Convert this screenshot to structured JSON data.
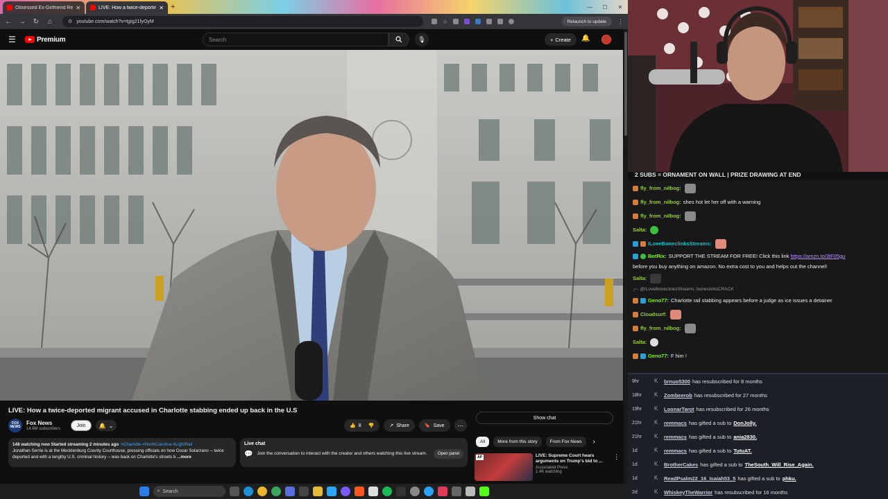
{
  "browser": {
    "tabs": [
      {
        "title": "Obsessed Ex-Girlfriend Refuses",
        "active": false
      },
      {
        "title": "LIVE: How a twice-deported",
        "active": true
      }
    ],
    "url": "youtube.com/watch?v=tgIg21fyOyM",
    "relaunch_label": "Relaunch to update"
  },
  "youtube": {
    "brand": "Premium",
    "search_placeholder": "Search",
    "create_label": "Create",
    "video_title": "LIVE: How a twice-deported migrant accused in Charlotte stabbing ended up back in the U.S",
    "channel": {
      "name": "Fox News",
      "subscribers": "14.6M subscribers",
      "avatar_text": "FOX NEWS"
    },
    "join_label": "Join",
    "like_count": "8",
    "share_label": "Share",
    "save_label": "Save",
    "description": {
      "stats": "148 watching now  Started streaming 2 minutes ago",
      "tags": "#Charlotte #NorthCarolina #LightRail",
      "body": "Jonathan Serrie is at the Mecklenburg County Courthouse, pressing officials on how Oscar Solarzano -- twice deported and with a lengthy U.S. criminal history -- was back on Charlotte's streets b",
      "more": "...more"
    },
    "live_chat": {
      "heading": "Live chat",
      "text": "Join the conversation to interact with the creator and others watching this live stream.",
      "open_panel": "Open panel"
    },
    "show_chat": "Show chat",
    "chips": [
      "All",
      "More from this story",
      "From Fox News"
    ],
    "recommendation": {
      "title": "LIVE: Supreme Court hears arguments on Trump's bid to ...",
      "channel": "Associated Press",
      "watching": "1.4K watching",
      "thumb_badge": "AP"
    }
  },
  "taskbar": {
    "search_label": "Search"
  },
  "stream": {
    "banner": "2 SUBS = ORNAMENT ON WALL | PRIZE DRAWING AT END",
    "chat": [
      {
        "user": "fly_from_nilbog:",
        "color": "#9acd32",
        "text": "",
        "emote": "cat"
      },
      {
        "user": "fly_from_nilbog:",
        "color": "#9acd32",
        "text": "shes hot let her off with a warning",
        "emote": ""
      },
      {
        "user": "fly_from_nilbog:",
        "color": "#9acd32",
        "text": "",
        "emote": "cat"
      },
      {
        "user": "Salta:",
        "color": "#9acd32",
        "text": "",
        "emote": "green"
      },
      {
        "user": "ILoveBoneclinksStreams:",
        "color": "#00c8c8",
        "text": "",
        "emote": "face"
      },
      {
        "user": "BotRix:",
        "color": "#7cfc00",
        "text": "SUPPORT THE STREAM FOR FREE! Click this link",
        "link": "https://amzn.to/3tF05gu",
        "text2": "before you buy anything on amazon. No extra cost to you and helps out the channel!"
      },
      {
        "user": "Salta:",
        "color": "#9acd32",
        "text": "",
        "emote": "dark"
      },
      {
        "reply": "@ILoveBoneclinksStreams: boneclinksCRACK"
      },
      {
        "user": "Geno77:",
        "color": "#7cfc00",
        "text": "Charlotte rail stabbing appears before a judge as ice issues a detainer",
        "emote": ""
      },
      {
        "user": "Cloudsurf:",
        "color": "#9acd32",
        "text": "",
        "emote": "face"
      },
      {
        "user": "fly_from_nilbog:",
        "color": "#9acd32",
        "text": "",
        "emote": "cat"
      },
      {
        "user": "Salta:",
        "color": "#9acd32",
        "text": "",
        "emote": "skull"
      },
      {
        "user": "Geno77:",
        "color": "#7cfc00",
        "text": "F him !",
        "emote": ""
      }
    ],
    "events": [
      {
        "age": "9hr",
        "user": "brnuo5300",
        "text": "has resubscribed for 8 months",
        "to": ""
      },
      {
        "age": "18hr",
        "user": "Zombeerob",
        "text": "has resubscribed for 27 months",
        "to": ""
      },
      {
        "age": "19hr",
        "user": "LoonarTarot",
        "text": "has resubscribed for 26 months",
        "to": ""
      },
      {
        "age": "21hr",
        "user": "remmacs",
        "text": "has gifted a sub to",
        "to": "DonJolly."
      },
      {
        "age": "21hr",
        "user": "remmacs",
        "text": "has gifted a sub to",
        "to": "ania2830."
      },
      {
        "age": "1d",
        "user": "remmacs",
        "text": "has gifted a sub to",
        "to": "TutuAT."
      },
      {
        "age": "1d",
        "user": "BrotherCakes",
        "text": "has gifted a sub to",
        "to": "TheSouth_Will_Rise_Again."
      },
      {
        "age": "1d",
        "user": "ReadPsalm22_16_Isaiah53_5",
        "text": "has gifted a sub to",
        "to": "phku."
      },
      {
        "age": "2d",
        "user": "WhiskeyTheWarrior",
        "text": "has resubscribed for 16 months",
        "to": ""
      }
    ]
  }
}
